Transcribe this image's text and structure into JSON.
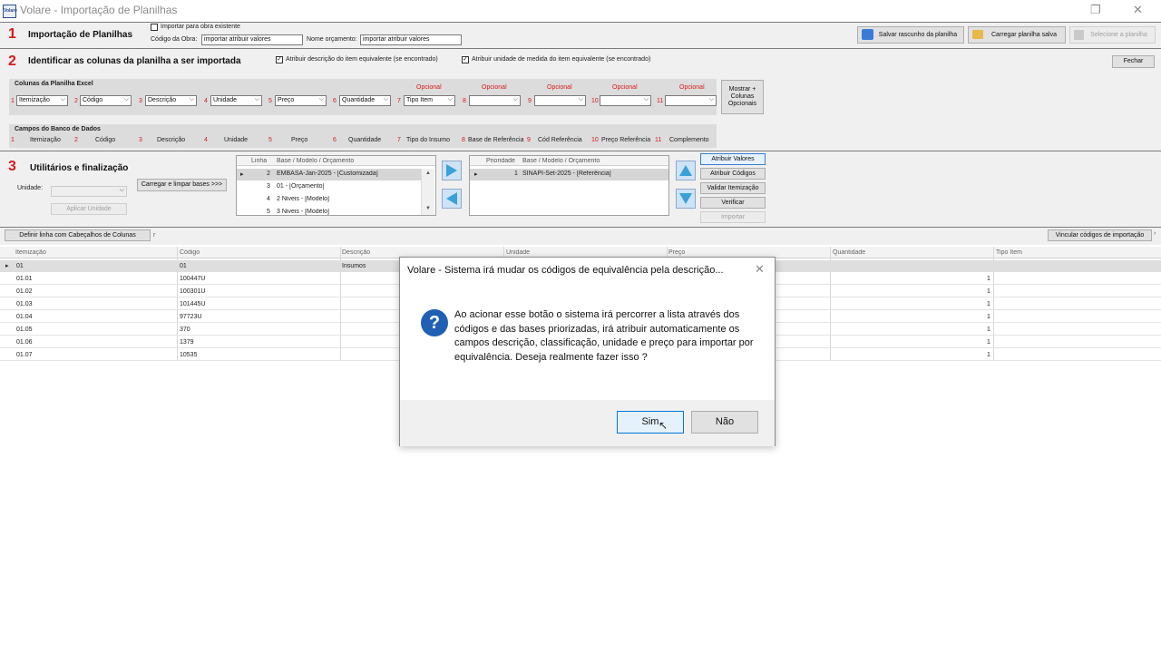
{
  "window": {
    "title": "Volare - Importação de Planilhas",
    "logo": "Volare",
    "restore_icon": "restore-icon",
    "close_icon": "close-icon"
  },
  "section1": {
    "number": "1",
    "title": "Importação de Planilhas",
    "checkbox_label": "Importar para obra existente",
    "codigo_label": "Código da Obra:",
    "codigo_value": "importar atribuir valores",
    "nome_label": "Nome orçamento:",
    "nome_value": "importar atribuir valores",
    "btn_salvar": "Salvar rascunho da planilha",
    "btn_carregar": "Carregar planilha salva",
    "btn_selecione": "Selecione a planilha"
  },
  "section2": {
    "number": "2",
    "title": "Identificar as colunas da planilha a ser importada",
    "chk_desc": "Atribuir descrição do item equivalente (se encontrado)",
    "chk_unid": "Atribuir unidade de medida do item equivalente (se encontrado)",
    "btn_fechar": "Fechar",
    "colunas_title": "Colunas da Planilha Excel",
    "opcional": "Opcional",
    "selects": [
      {
        "n": "1",
        "v": "Itemização"
      },
      {
        "n": "2",
        "v": "Código"
      },
      {
        "n": "3",
        "v": "Descrição"
      },
      {
        "n": "4",
        "v": "Unidade"
      },
      {
        "n": "5",
        "v": "Preço"
      },
      {
        "n": "6",
        "v": "Quantidade"
      },
      {
        "n": "7",
        "v": "Tipo Item"
      },
      {
        "n": "8",
        "v": ""
      },
      {
        "n": "9",
        "v": ""
      },
      {
        "n": "10",
        "v": ""
      },
      {
        "n": "11",
        "v": ""
      }
    ],
    "btn_mostrar": "Mostrar + Colunas Opcionais",
    "campos_title": "Campos do Banco de Dados",
    "campos": [
      {
        "n": "1",
        "v": "Itemização"
      },
      {
        "n": "2",
        "v": "Código"
      },
      {
        "n": "3",
        "v": "Descrição"
      },
      {
        "n": "4",
        "v": "Unidade"
      },
      {
        "n": "5",
        "v": "Preço"
      },
      {
        "n": "6",
        "v": "Quantidade"
      },
      {
        "n": "7",
        "v": "Tipo do Insumo"
      },
      {
        "n": "8",
        "v": "Base de Referência"
      },
      {
        "n": "9",
        "v": "Cód Referência"
      },
      {
        "n": "10",
        "v": "Preço Referência"
      },
      {
        "n": "11",
        "v": "Complemento"
      }
    ]
  },
  "section3": {
    "number": "3",
    "title": "Utilitários e finalização",
    "unidade_label": "Unidade:",
    "btn_aplicar": "Aplicar Unidade",
    "btn_carregar_bases": "Carregar e limpar bases >>>",
    "bases_head": {
      "linha": "Linha",
      "base": "Base / Modelo / Orçamento"
    },
    "bases": [
      {
        "linha": "2",
        "base": "EMBASA-Jan-2025 - [Customizada]"
      },
      {
        "linha": "3",
        "base": "01 - [Orçamento]"
      },
      {
        "linha": "4",
        "base": "2 Niveis - [Modelo]"
      },
      {
        "linha": "5",
        "base": "3 Niveis - [Modelo]"
      }
    ],
    "prior_head": {
      "prioridade": "Prioridade",
      "base": "Base / Modelo / Orçamento"
    },
    "prior": [
      {
        "p": "1",
        "base": "SINAPI-Set-2025 - [Referência]"
      }
    ],
    "btn_atribuir_valores": "Atribuir Valores",
    "btn_atribuir_codigos": "Atribuir Códigos",
    "btn_validar": "Validar Itemização",
    "btn_verificar": "Verificar",
    "btn_importar": "Importar"
  },
  "toolbar": {
    "btn_definir": "Definir linha com Cabeçalhos de Colunas",
    "trailing": "r",
    "btn_vincular": "Vincular códigos de importação"
  },
  "table": {
    "headers": [
      "Itemização",
      "Código",
      "Descrição",
      "Unidade",
      "Preço",
      "Quantidade",
      "Tipo Item"
    ],
    "rows": [
      {
        "item": "01",
        "codigo": "01",
        "desc": "Insumos",
        "qtd": ""
      },
      {
        "item": "01.01",
        "codigo": "100447U",
        "desc": "",
        "qtd": "1"
      },
      {
        "item": "01.02",
        "codigo": "100301U",
        "desc": "",
        "qtd": "1"
      },
      {
        "item": "01.03",
        "codigo": "101445U",
        "desc": "",
        "qtd": "1"
      },
      {
        "item": "01.04",
        "codigo": "97723U",
        "desc": "",
        "qtd": "1"
      },
      {
        "item": "01.05",
        "codigo": "370",
        "desc": "",
        "qtd": "1"
      },
      {
        "item": "01.06",
        "codigo": "1379",
        "desc": "",
        "qtd": "1"
      },
      {
        "item": "01.07",
        "codigo": "10535",
        "desc": "",
        "qtd": "1"
      }
    ]
  },
  "dialog": {
    "title": "Volare - Sistema irá mudar os códigos de equivalência pela descrição...",
    "message": "Ao acionar esse botão o sistema irá percorrer a lista através dos códigos e das bases priorizadas, irá atribuir automaticamente os campos descrição, classificação, unidade e preço para importar por equivalência. Deseja realmente fazer isso ?",
    "btn_yes": "Sim",
    "btn_no": "Não",
    "icon": "question-icon"
  }
}
